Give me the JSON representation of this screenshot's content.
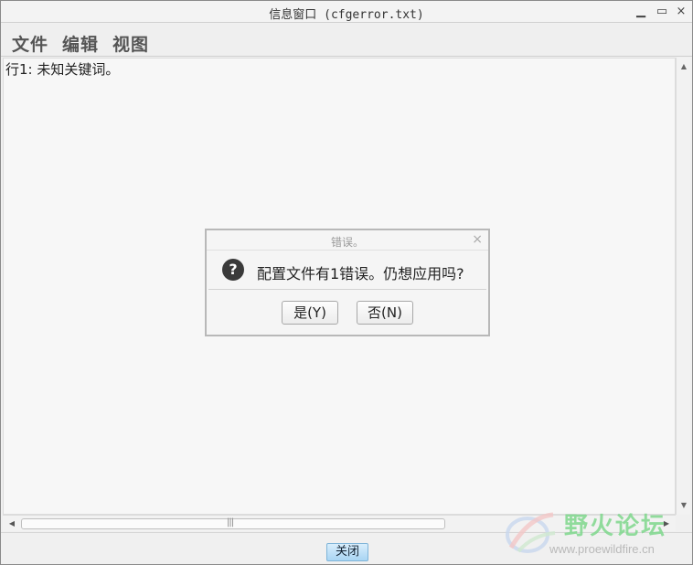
{
  "window": {
    "title": "信息窗口 (cfgerror.txt)",
    "minimize_glyph": "▁",
    "maximize_glyph": "▭",
    "close_glyph": "×"
  },
  "menubar": {
    "items": [
      {
        "label": "文件"
      },
      {
        "label": "编辑"
      },
      {
        "label": "视图"
      }
    ]
  },
  "content": {
    "lines": [
      "行1: 未知关键词。"
    ]
  },
  "scrollbars": {
    "horizontal_grip": "|||"
  },
  "footer": {
    "close_label": "关闭"
  },
  "dialog": {
    "title": "错误。",
    "close_glyph": "×",
    "icon": "question-icon",
    "icon_glyph": "?",
    "message": "配置文件有1错误。仍想应用吗?",
    "yes_label": "是(Y)",
    "no_label": "否(N)"
  },
  "watermark": {
    "text": "野火论坛",
    "url": "www.proewildfire.cn"
  },
  "colors": {
    "close_button": "#a9d5f3",
    "watermark_text": "#7fd88d"
  }
}
